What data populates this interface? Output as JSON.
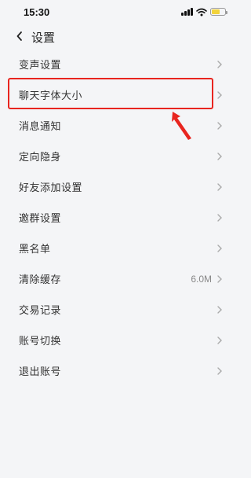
{
  "status_bar": {
    "time": "15:30"
  },
  "header": {
    "title": "设置"
  },
  "settings": [
    {
      "label": "变声设置",
      "value": ""
    },
    {
      "label": "聊天字体大小",
      "value": ""
    },
    {
      "label": "消息通知",
      "value": ""
    },
    {
      "label": "定向隐身",
      "value": ""
    },
    {
      "label": "好友添加设置",
      "value": ""
    },
    {
      "label": "邀群设置",
      "value": ""
    },
    {
      "label": "黑名单",
      "value": ""
    },
    {
      "label": "清除缓存",
      "value": "6.0M"
    },
    {
      "label": "交易记录",
      "value": ""
    },
    {
      "label": "账号切换",
      "value": ""
    },
    {
      "label": "退出账号",
      "value": ""
    }
  ],
  "icons": {
    "back": "chevron-left-icon",
    "row_arrow": "chevron-right-icon",
    "signal": "cellular-signal-icon",
    "wifi": "wifi-icon",
    "battery": "battery-charging-icon"
  },
  "colors": {
    "background": "#f4f5f7",
    "highlight": "#e8251f",
    "battery_fill": "#f2d33b"
  },
  "annotation": {
    "highlighted_item": "聊天字体大小"
  }
}
